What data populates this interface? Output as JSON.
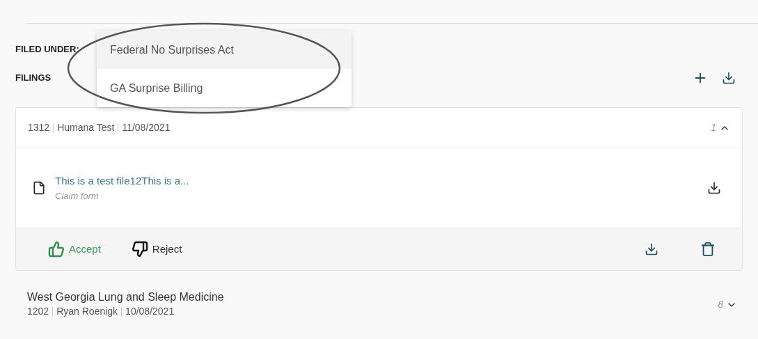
{
  "filed_under": {
    "label": "FILED UNDER:",
    "dropdown": {
      "options": [
        {
          "label": "Federal No Surprises Act",
          "selected": true
        },
        {
          "label": "GA Surprise Billing",
          "selected": false
        }
      ]
    }
  },
  "filings_label": "FILINGS",
  "filings": [
    {
      "meta": [
        "1312",
        "Humana Test",
        "11/08/2021"
      ],
      "count": "1",
      "expanded": true,
      "files": [
        {
          "name": "This is a test file12This is a...",
          "type": "Claim form"
        }
      ],
      "actions": {
        "accept": "Accept",
        "reject": "Reject"
      }
    },
    {
      "title": "West Georgia Lung and Sleep Medicine",
      "meta": [
        "1202",
        "Ryan Roenigk",
        "10/08/2021"
      ],
      "count": "8",
      "expanded": false
    }
  ]
}
